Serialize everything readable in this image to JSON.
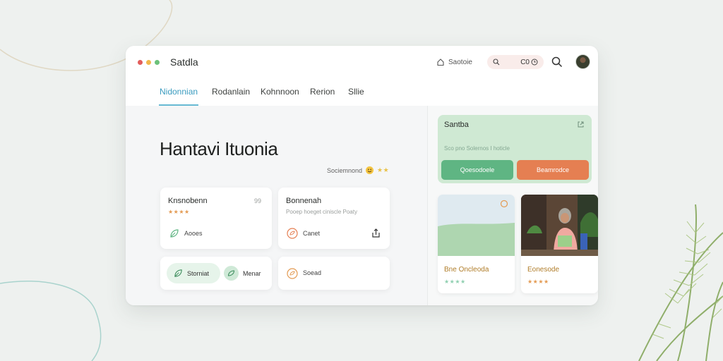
{
  "app": {
    "title": "Satdla",
    "home_label": "Saotoie",
    "search_value": "C0",
    "traffic_colors": [
      "#e35d5b",
      "#f2b84b",
      "#6cc17a"
    ]
  },
  "tabs": [
    {
      "label": "Nidonnian",
      "active": true
    },
    {
      "label": "Rodanlain",
      "active": false
    },
    {
      "label": "Kohnnoon",
      "active": false
    },
    {
      "label": "Rerion",
      "active": false
    },
    {
      "label": "Sllie",
      "active": false
    }
  ],
  "main": {
    "title": "Hantavi Ituonia",
    "rating_label": "Sociemnond",
    "rating_stars": "★★",
    "cards": [
      {
        "title": "Knsnobenn",
        "stars": "★★★★",
        "meta_label": "Aooes",
        "icon": "leaf-icon",
        "badge": "99"
      },
      {
        "title": "Bonnenah",
        "subtitle": "Pooep hoeget ciniscle Poaty",
        "meta_label": "Canet",
        "icon": "leaf-circle-icon",
        "action_icon": "share-icon"
      }
    ],
    "chips": [
      {
        "label": "Storniat",
        "icon": "leaf-icon"
      },
      {
        "label": "Menar",
        "icon": "leaf-circle-icon"
      }
    ],
    "bottom_card_label": "Soead"
  },
  "sidebar": {
    "promo": {
      "title": "Santba",
      "subtitle": "Sco pno Solernos I hoticle",
      "primary_button": "Qoesodoele",
      "secondary_button": "Beamrodce",
      "primary_color": "#5fb583",
      "secondary_color": "#e57f52"
    },
    "products": [
      {
        "name": "Bne Oncleoda",
        "stars": "★★★★",
        "star_color": "#8fcfb0",
        "icon": "landscape-thumbnail"
      },
      {
        "name": "Eonesode",
        "stars": "★★★★",
        "star_color": "#e39a52",
        "icon": "portrait-photo"
      }
    ]
  }
}
